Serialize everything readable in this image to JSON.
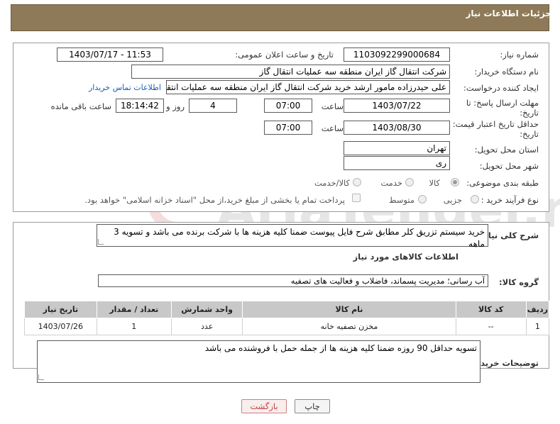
{
  "header": {
    "title": "جزئیات اطلاعات نیاز"
  },
  "form": {
    "need_number": {
      "label": "شماره نیاز:",
      "value": "1103092299000684"
    },
    "announce_datetime": {
      "label": "تاریخ و ساعت اعلان عمومی:",
      "value": "1403/07/17 - 11:53"
    },
    "buyer_org": {
      "label": "نام دستگاه خریدار:",
      "value": "شرکت انتقال گاز ایران منطقه سه عملیات انتقال گاز"
    },
    "requester": {
      "label": "ایجاد کننده درخواست:",
      "value": "علی حیدرزاده مامور ارشد خرید شرکت انتقال گاز ایران منطقه سه عملیات انتقال",
      "contact_link": "اطلاعات تماس خریدار"
    },
    "reply_deadline": {
      "label_line1": "مهلت ارسال پاسخ: تا",
      "label_line2": "تاریخ:",
      "date": "1403/07/22",
      "time_label": "ساعت",
      "time": "07:00",
      "days": "4",
      "days_label": "روز و",
      "remaining": "18:14:42",
      "remaining_label": "ساعت باقی مانده"
    },
    "price_validity": {
      "label_line1": "حداقل تاریخ اعتبار قیمت: تا",
      "label_line2": "تاریخ:",
      "date": "1403/08/30",
      "time_label": "ساعت",
      "time": "07:00"
    },
    "delivery_province": {
      "label": "استان محل تحویل:",
      "value": "تهران"
    },
    "delivery_city": {
      "label": "شهر محل تحویل:",
      "value": "ری"
    },
    "category": {
      "label": "طبقه بندی موضوعی:",
      "options": [
        "کالا",
        "خدمت",
        "کالا/خدمت"
      ],
      "selected": "کالا"
    },
    "purchase_type": {
      "label": "نوع فرآیند خرید :",
      "options": [
        "جزیی",
        "متوسط"
      ],
      "payment_note": "پرداخت تمام یا بخشی از مبلغ خرید،از محل \"اسناد خزانه اسلامی\" خواهد بود."
    }
  },
  "description": {
    "label": "شرح کلی نیاز:",
    "value": "خرید سیستم تزریق کلر مطابق شرح فایل پیوست ضمنا کلیه هزینه ها با شرکت برنده می باشد و تسویه 3 ماهه"
  },
  "goods_info": {
    "title": "اطلاعات کالاهای مورد نیاز",
    "group_label": "گروه کالا:",
    "group_value": "آب رسانی؛ مدیریت پسماند، فاضلاب و فعالیت های تصفیه"
  },
  "table": {
    "headers": [
      "ردیف",
      "کد کالا",
      "نام کالا",
      "واحد شمارش",
      "تعداد / مقدار",
      "تاریخ نیاز"
    ],
    "rows": [
      [
        "1",
        "--",
        "مخزن تصفیه خانه",
        "عدد",
        "1",
        "1403/07/26"
      ]
    ]
  },
  "buyer_notes": {
    "label": "توضیحات خریدار:",
    "value": "تسویه حداقل 90 روزه ضمنا کلیه هزینه ها از جمله حمل با فروشنده می باشد"
  },
  "buttons": {
    "print": "چاپ",
    "back": "بازگشت"
  },
  "watermark_text": "AriaTender.neT",
  "colors": {
    "header": "#8e7a58",
    "back_button_border": "#d08080",
    "link": "#1a5fb4"
  }
}
